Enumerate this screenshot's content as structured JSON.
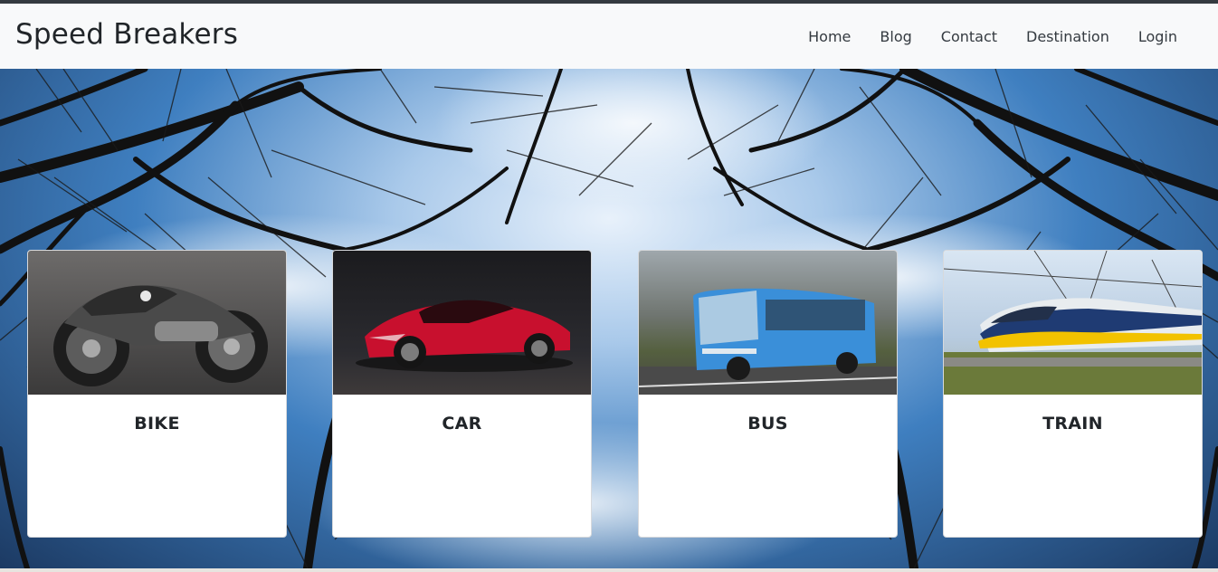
{
  "navbar": {
    "brand": "Speed Breakers",
    "links": [
      "Home",
      "Blog",
      "Contact",
      "Destination",
      "Login"
    ]
  },
  "cards": [
    {
      "title": "BIKE",
      "image": "motorcycle-photo"
    },
    {
      "title": "CAR",
      "image": "red-sports-car-photo"
    },
    {
      "title": "BUS",
      "image": "blue-bus-photo"
    },
    {
      "title": "TRAIN",
      "image": "high-speed-train-photo"
    }
  ],
  "colors": {
    "navbar_bg": "#f8f9fa",
    "text": "#212529",
    "sky": "#3f7fc0",
    "car_red": "#c8102e",
    "bus_blue": "#3a8fd9",
    "train_yellow": "#f2c200"
  }
}
